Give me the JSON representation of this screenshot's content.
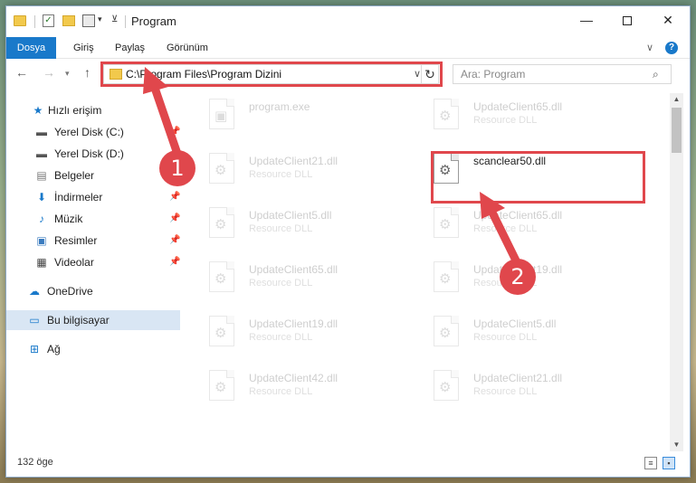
{
  "window": {
    "title": "Program",
    "controls": {
      "minimize": "—",
      "maximize": "",
      "close": "✕"
    }
  },
  "ribbon": {
    "file_tab": "Dosya",
    "tabs": [
      "Giriş",
      "Paylaş",
      "Görünüm"
    ],
    "help": "?"
  },
  "nav": {
    "address": "C:\\Program Files\\Program Dizini",
    "search_placeholder": "Ara: Program"
  },
  "sidebar": {
    "items": [
      {
        "label": "Hızlı erişim",
        "icon": "star-icon",
        "pinned": false
      },
      {
        "label": "Yerel Disk (C:)",
        "icon": "drive-icon",
        "pinned": true
      },
      {
        "label": "Yerel Disk (D:)",
        "icon": "drive-icon",
        "pinned": true
      },
      {
        "label": "Belgeler",
        "icon": "documents-icon",
        "pinned": true
      },
      {
        "label": "İndirmeler",
        "icon": "download-icon",
        "pinned": true
      },
      {
        "label": "Müzik",
        "icon": "music-icon",
        "pinned": true
      },
      {
        "label": "Resimler",
        "icon": "pictures-icon",
        "pinned": true
      },
      {
        "label": "Videolar",
        "icon": "videos-icon",
        "pinned": true
      },
      {
        "label": "OneDrive",
        "icon": "cloud-icon",
        "pinned": false
      },
      {
        "label": "Bu bilgisayar",
        "icon": "computer-icon",
        "pinned": false
      },
      {
        "label": "Ağ",
        "icon": "network-icon",
        "pinned": false
      }
    ]
  },
  "files": [
    {
      "name": "program.exe",
      "type": ""
    },
    {
      "name": "UpdateClient65.dll",
      "type": "Resource DLL"
    },
    {
      "name": "UpdateClient21.dll",
      "type": "Resource DLL"
    },
    {
      "name": "scanclear50.dll",
      "type": ""
    },
    {
      "name": "UpdateClient5.dll",
      "type": "Resource DLL"
    },
    {
      "name": "UpdateClient65.dll",
      "type": "Resource DLL"
    },
    {
      "name": "UpdateClient65.dll",
      "type": "Resource DLL"
    },
    {
      "name": "UpdateClient19.dll",
      "type": "Resource DLL"
    },
    {
      "name": "UpdateClient19.dll",
      "type": "Resource DLL"
    },
    {
      "name": "UpdateClient5.dll",
      "type": "Resource DLL"
    },
    {
      "name": "UpdateClient42.dll",
      "type": "Resource DLL"
    },
    {
      "name": "UpdateClient21.dll",
      "type": "Resource DLL"
    }
  ],
  "status": {
    "count": "132 öge"
  },
  "annotations": {
    "badge1": "1",
    "badge2": "2",
    "color": "#e0474c"
  }
}
